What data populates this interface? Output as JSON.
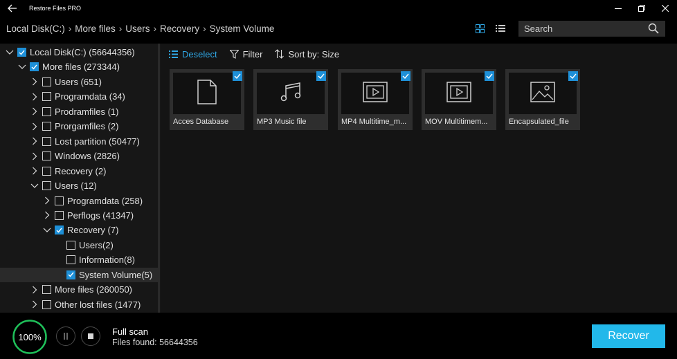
{
  "window": {
    "title": "Restore Files PRO"
  },
  "breadcrumb": [
    "Local Disk(C:)",
    "More files",
    "Users",
    "Recovery",
    "System Volume"
  ],
  "search": {
    "placeholder": "Search"
  },
  "tree": [
    {
      "label": "Local Disk(C:) (56644356)",
      "level": 0,
      "expanded": true,
      "checked": true,
      "selected": false
    },
    {
      "label": "More files (273344)",
      "level": 1,
      "expanded": true,
      "checked": true,
      "selected": false
    },
    {
      "label": "Users (651)",
      "level": 2,
      "expanded": false,
      "checked": false,
      "selected": false
    },
    {
      "label": "Programdata (34)",
      "level": 2,
      "expanded": false,
      "checked": false,
      "selected": false
    },
    {
      "label": "Prodramfiles (1)",
      "level": 2,
      "expanded": false,
      "checked": false,
      "selected": false
    },
    {
      "label": "Prorgamfiles (2)",
      "level": 2,
      "expanded": false,
      "checked": false,
      "selected": false
    },
    {
      "label": "Lost partition (50477)",
      "level": 2,
      "expanded": false,
      "checked": false,
      "selected": false
    },
    {
      "label": "Windows (2826)",
      "level": 2,
      "expanded": false,
      "checked": false,
      "selected": false
    },
    {
      "label": "Recovery (2)",
      "level": 2,
      "expanded": false,
      "checked": false,
      "selected": false
    },
    {
      "label": "Users (12)",
      "level": 2,
      "expanded": true,
      "checked": false,
      "selected": false
    },
    {
      "label": "Programdata (258)",
      "level": 3,
      "expanded": false,
      "checked": false,
      "selected": false
    },
    {
      "label": "Perflogs (41347)",
      "level": 3,
      "expanded": false,
      "checked": false,
      "selected": false
    },
    {
      "label": "Recovery (7)",
      "level": 3,
      "expanded": true,
      "checked": true,
      "selected": false
    },
    {
      "label": "Users(2)",
      "level": 4,
      "expanded": null,
      "checked": false,
      "selected": false
    },
    {
      "label": "Information(8)",
      "level": 4,
      "expanded": null,
      "checked": false,
      "selected": false
    },
    {
      "label": "System Volume(5)",
      "level": 4,
      "expanded": null,
      "checked": true,
      "selected": true
    },
    {
      "label": "More files (260050)",
      "level": 2,
      "expanded": false,
      "checked": false,
      "selected": false
    },
    {
      "label": "Other lost files (1477)",
      "level": 2,
      "expanded": false,
      "checked": false,
      "selected": false
    }
  ],
  "toolbar": {
    "deselect_label": "Deselect",
    "filter_label": "Filter",
    "sort_label": "Sort by: Size"
  },
  "files": [
    {
      "name": "Acces Database",
      "icon": "document-icon",
      "checked": true
    },
    {
      "name": "MP3 Music file",
      "icon": "music-note-icon",
      "checked": true
    },
    {
      "name": "MP4 Multitime_m...",
      "icon": "video-icon",
      "checked": true
    },
    {
      "name": "MOV Multitimem...",
      "icon": "video-icon",
      "checked": true
    },
    {
      "name": "Encapsulated_file",
      "icon": "image-icon",
      "checked": true
    }
  ],
  "footer": {
    "progress_text": "100%",
    "progress_fraction": 1.0,
    "scan_title": "Full scan",
    "files_found": "Files found: 56644356",
    "recover_label": "Recover"
  },
  "colors": {
    "accent": "#1e90d8",
    "recover_button": "#22b8ea",
    "progress_ring": "#1fc05a"
  }
}
